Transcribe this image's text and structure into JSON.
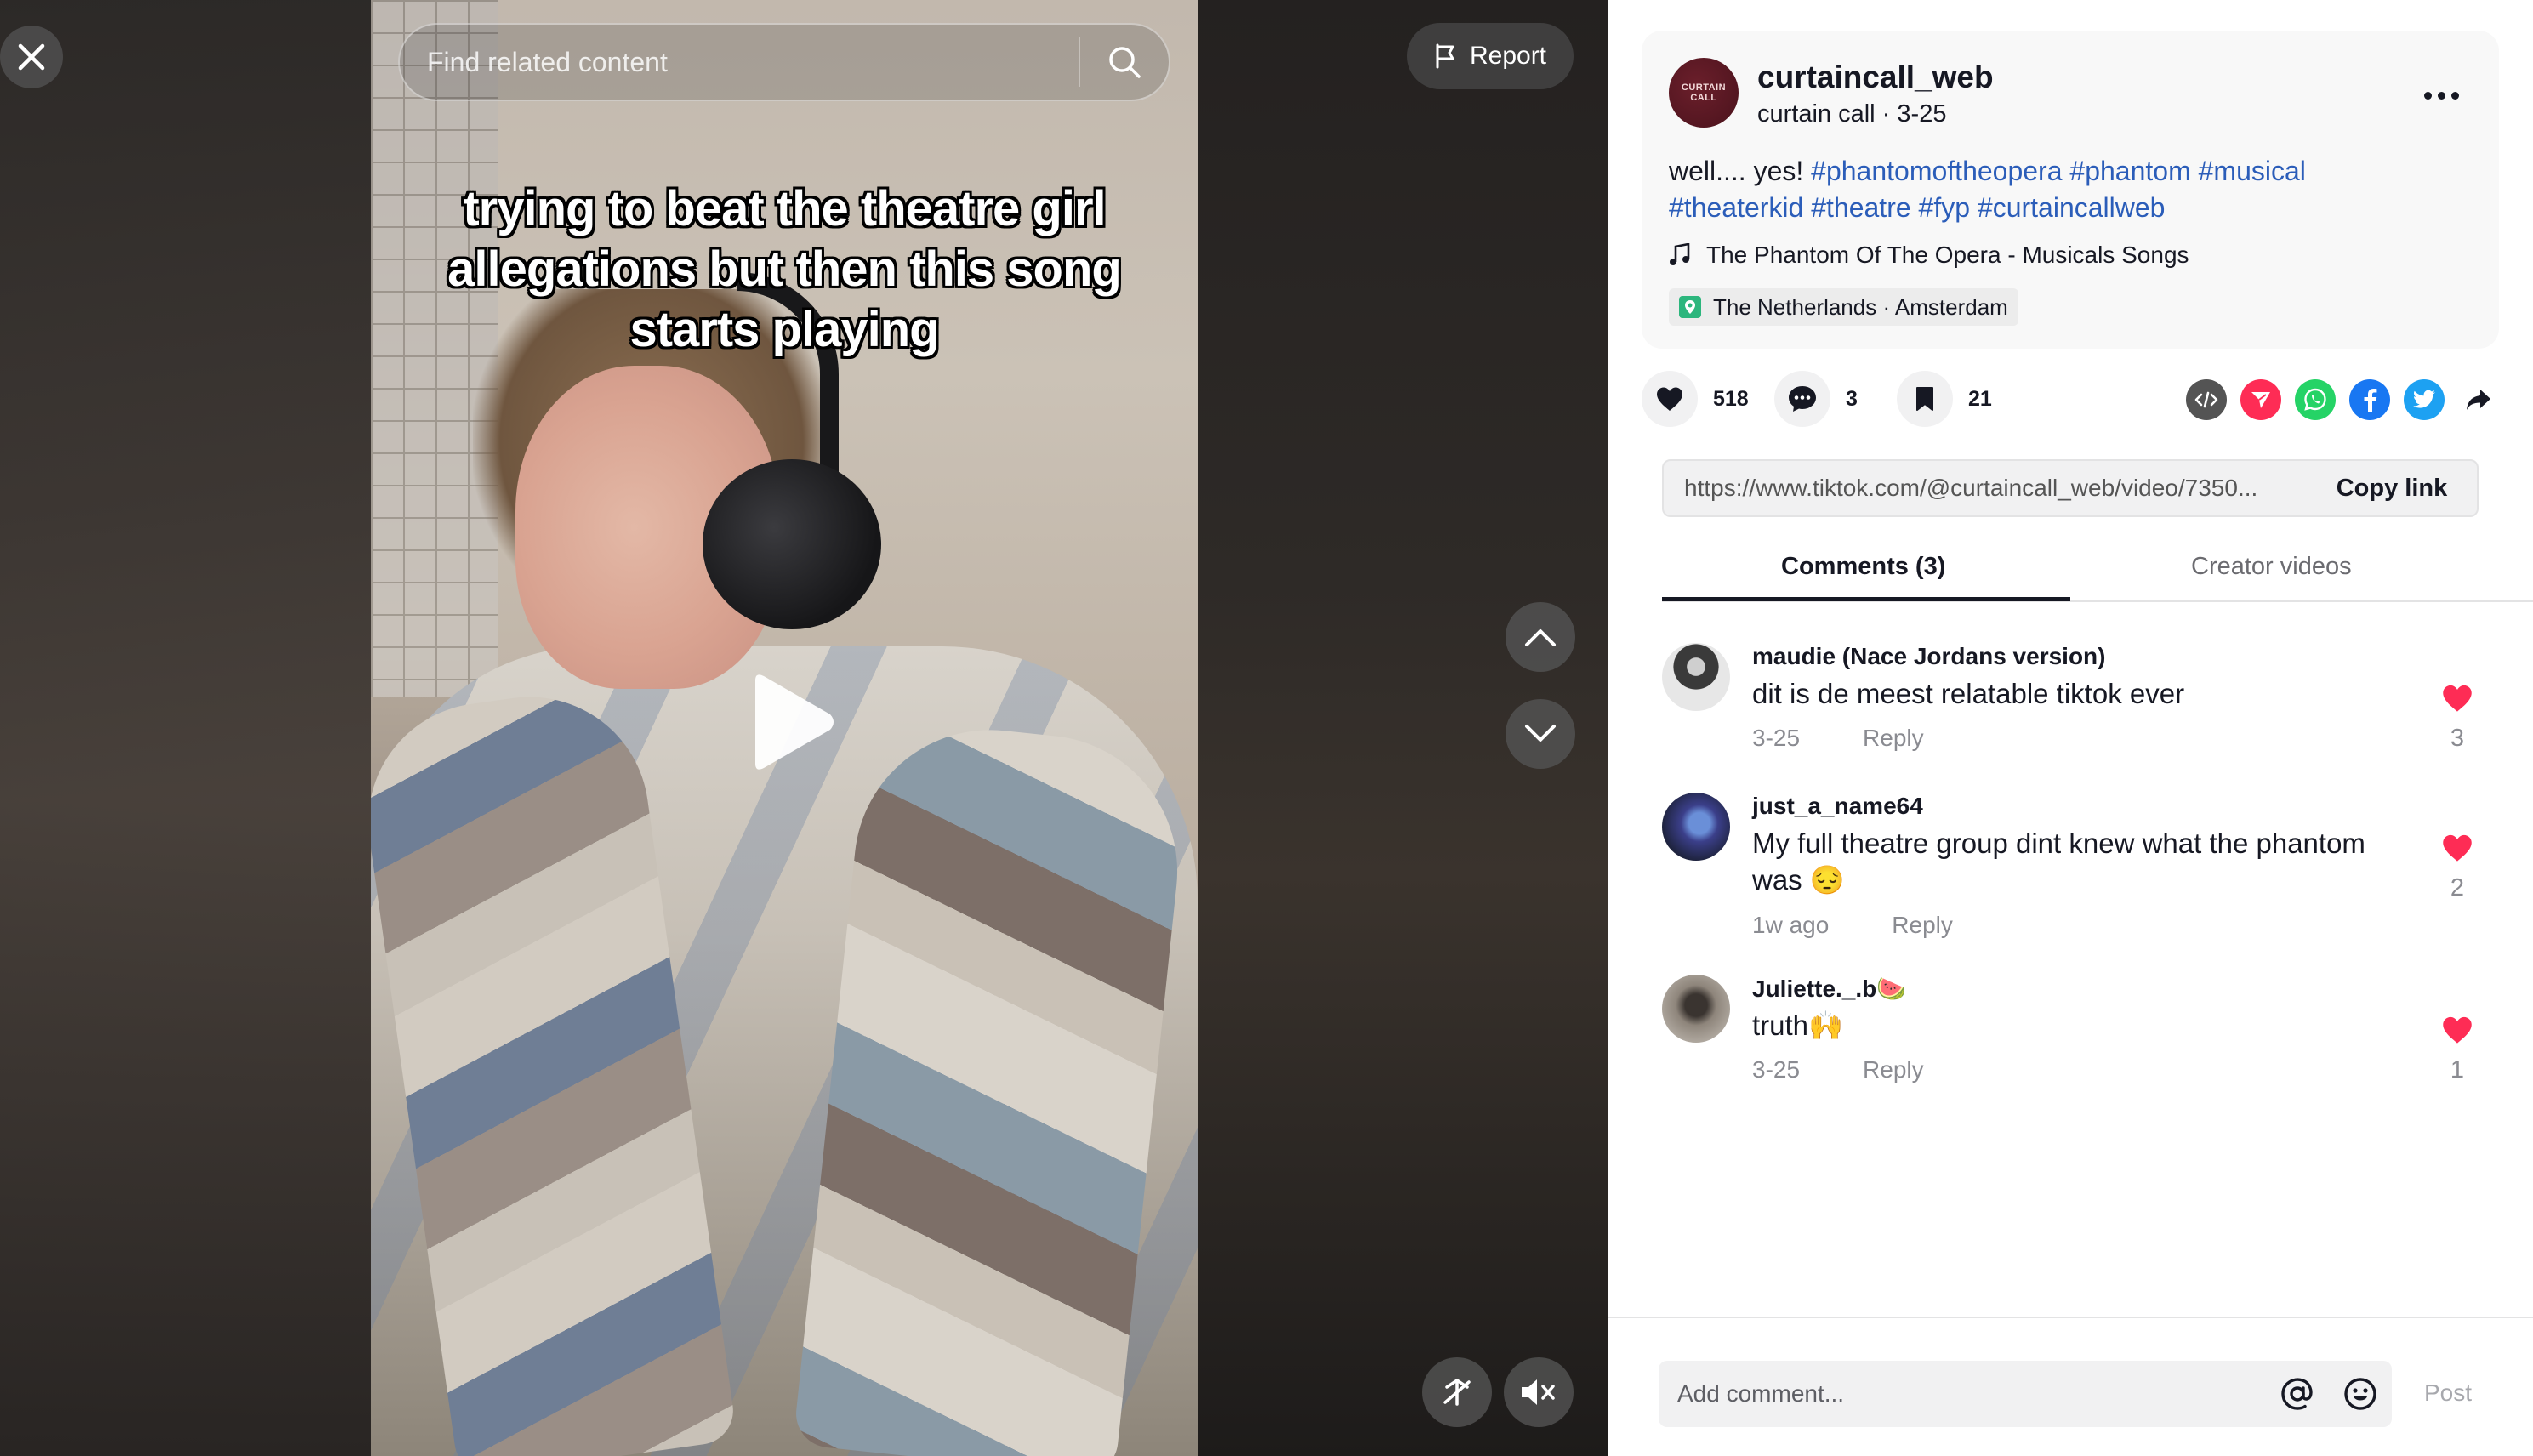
{
  "video": {
    "caption": "trying to beat the theatre girl allegations but then this song starts playing",
    "search_placeholder": "Find related content",
    "report_label": "Report"
  },
  "post": {
    "avatar_text": "CURTAIN CALL",
    "username": "curtaincall_web",
    "nickname": "curtain call",
    "date": "3-25",
    "description_prefix": "well.... yes! ",
    "hashtags_line1": [
      "#phantomoftheopera",
      "#phantom",
      "#musical"
    ],
    "hashtags_line2": [
      "#theaterkid",
      "#theatre",
      "#fyp",
      "#curtaincallweb"
    ],
    "music": "The Phantom Of The Opera - Musicals Songs",
    "location": "The Netherlands · Amsterdam"
  },
  "actions": {
    "likes": "518",
    "comments": "3",
    "saves": "21",
    "share_icons": [
      "embed-icon",
      "send-to-friends-icon",
      "whatsapp-icon",
      "facebook-icon",
      "twitter-icon",
      "share-arrow-icon"
    ]
  },
  "link": {
    "url": "https://www.tiktok.com/@curtaincall_web/video/7350...",
    "copy_label": "Copy link"
  },
  "tabs": {
    "comments": "Comments (3)",
    "creator_videos": "Creator videos"
  },
  "comments": [
    {
      "name": "maudie (Nace Jordans version)",
      "text": "dit is de meest relatable tiktok ever",
      "time": "3-25",
      "reply": "Reply",
      "likes": "3"
    },
    {
      "name": "just_a_name64",
      "text": "My full theatre group dint knew what the phantom was 😔",
      "time": "1w ago",
      "reply": "Reply",
      "likes": "2"
    },
    {
      "name": "Juliette._.b🍉",
      "text": "truth🙌",
      "time": "3-25",
      "reply": "Reply",
      "likes": "1"
    }
  ],
  "composer": {
    "placeholder": "Add comment...",
    "post_label": "Post"
  },
  "colors": {
    "hashtag": "#2b5db9",
    "like_red": "#fe2c55",
    "text": "#161823",
    "muted": "#8a8b91"
  }
}
